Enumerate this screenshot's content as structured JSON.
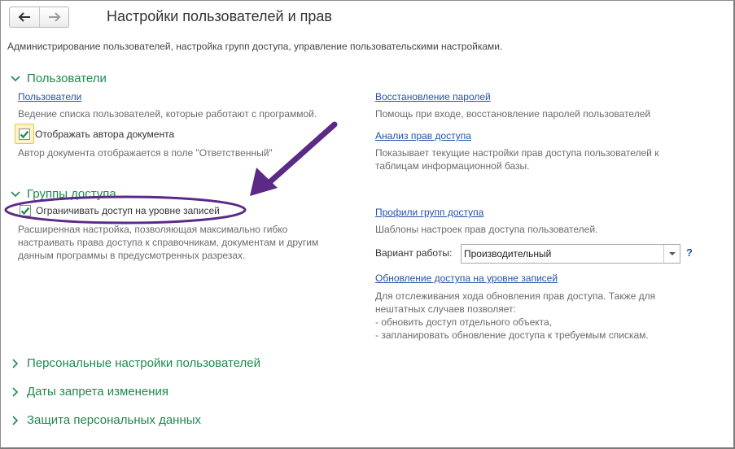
{
  "header": {
    "title": "Настройки пользователей и прав",
    "back_icon": "arrow-left-icon",
    "forward_icon": "arrow-right-icon"
  },
  "description": "Администрирование пользователей, настройка групп доступа, управление пользовательскими настройками.",
  "colors": {
    "section_green": "#1e8a4c",
    "link_blue": "#2452a8",
    "annotation_purple": "#5b2a86"
  },
  "sections": {
    "users": {
      "label": "Пользователи",
      "users_link": "Пользователи",
      "users_hint": "Ведение списка пользователей, которые работают с программой.",
      "show_author_label": "Отображать автора документа",
      "show_author_checked": true,
      "show_author_hint": "Автор документа отображается в поле \"Ответственный\"",
      "password_recovery_link": "Восстановление паролей",
      "password_recovery_hint": "Помощь при входе, восстановление паролей пользователей",
      "rights_analysis_link": "Анализ прав доступа",
      "rights_analysis_hint_1": "Показывает текущие настройки прав доступа пользователей к",
      "rights_analysis_hint_2": "таблицам информационной базы."
    },
    "access_groups": {
      "label": "Группы доступа",
      "restrict_label": "Ограничивать доступ на уровне записей",
      "restrict_checked": true,
      "restrict_hint_1": "Расширенная настройка, позволяющая максимально гибко",
      "restrict_hint_2": "настраивать права доступа к справочникам, документам и другим",
      "restrict_hint_3": "данным программы в предусмотренных разрезах.",
      "profiles_link": "Профили групп доступа",
      "profiles_hint": "Шаблоны настроек прав доступа пользователей.",
      "mode_label": "Вариант работы:",
      "mode_value": "Производительный",
      "help_label": "?",
      "update_link": "Обновление доступа на уровне записей",
      "update_hint_1": "Для отслеживания хода обновления прав доступа. Также для",
      "update_hint_2": "нештатных случаев позволяет:",
      "update_hint_3": "- обновить доступ отдельного объекта,",
      "update_hint_4": "- запланировать обновление доступа к требуемым спискам."
    },
    "personal_settings": {
      "label": "Персональные настройки пользователей"
    },
    "change_dates": {
      "label": "Даты запрета изменения"
    },
    "personal_data": {
      "label": "Защита персональных данных"
    }
  }
}
